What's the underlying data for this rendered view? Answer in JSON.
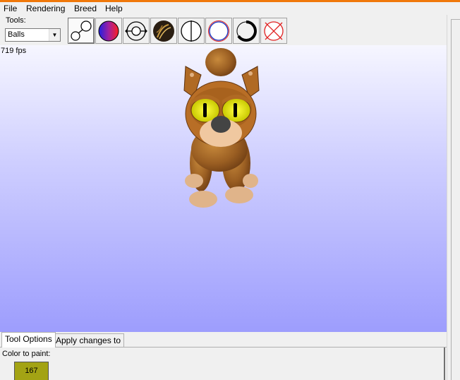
{
  "menu": {
    "file": "File",
    "rendering": "Rendering",
    "breed": "Breed",
    "help": "Help"
  },
  "toolbar": {
    "tools_label": "Tools:",
    "tool_select_value": "Balls",
    "buttons": [
      {
        "icon": "balls-link-icon",
        "active": true
      },
      {
        "icon": "paint-ball-icon",
        "active": false
      },
      {
        "icon": "resize-ball-icon",
        "active": false
      },
      {
        "icon": "fuzz-texture-icon",
        "active": false
      },
      {
        "icon": "split-ball-icon",
        "active": false
      },
      {
        "icon": "outline-ball-icon",
        "active": false
      },
      {
        "icon": "thick-outline-ball-icon",
        "active": false
      },
      {
        "icon": "delete-ball-icon",
        "active": false
      }
    ]
  },
  "viewport": {
    "fps": "719 fps"
  },
  "tabs": {
    "tool_options": "Tool Options",
    "apply_changes_to": "Apply changes to"
  },
  "panel": {
    "color_label": "Color to paint:",
    "color_value": "167",
    "color_hex": "#a3a314"
  },
  "colors": {
    "accent": "#f0780a",
    "viewport_top": "#f6f6ff",
    "viewport_bottom": "#9d9dfd"
  }
}
